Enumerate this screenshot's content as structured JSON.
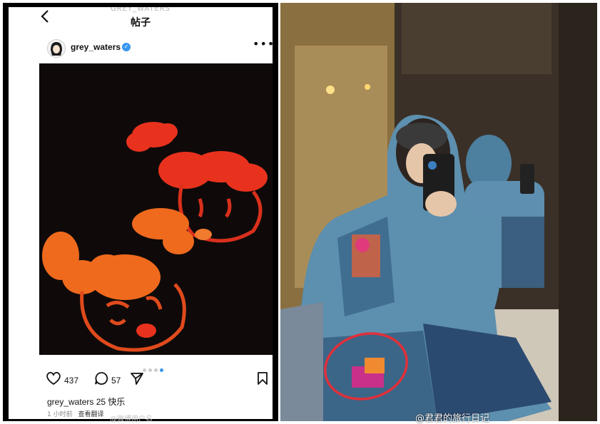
{
  "header": {
    "back_icon": "chevron-left-icon",
    "account_small": "GREY_WATERS",
    "title": "帖子"
  },
  "post": {
    "username": "grey_waters",
    "verified_icon": "verified-badge-icon",
    "more_icon": "more-dots-icon",
    "carousel": {
      "count": 4,
      "active_index": 3
    },
    "likes": "437",
    "comments": "57",
    "caption_user": "grey_waters",
    "caption_text": "25 快乐",
    "time": "1 小时前",
    "translate": "查看翻译"
  },
  "watermarks": {
    "left": "@微博用户名",
    "right": "@君君的旅行日记"
  },
  "colors": {
    "verified": "#3897f0",
    "embroidery_red": "#e8321e",
    "embroidery_orange": "#f06a1e",
    "highlight_circle": "#e0303a"
  }
}
